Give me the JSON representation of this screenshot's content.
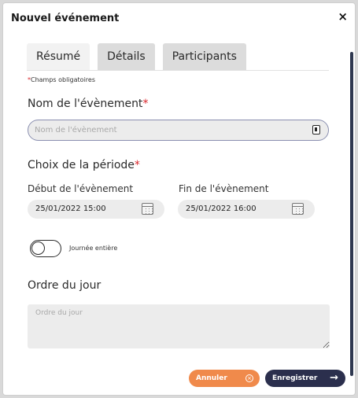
{
  "dialog": {
    "title": "Nouvel événement",
    "close_symbol": "×"
  },
  "tabs": [
    {
      "label": "Résumé",
      "active": true
    },
    {
      "label": "Détails",
      "active": false
    },
    {
      "label": "Participants",
      "active": false
    }
  ],
  "required_note": {
    "star": "*",
    "text": "Champs obligatoires"
  },
  "event_name": {
    "label": "Nom de l'évènement",
    "required_star": "*",
    "value": "",
    "placeholder": "Nom de l'évènement"
  },
  "period": {
    "label": "Choix de la période",
    "required_star": "*",
    "start": {
      "label": "Début de l'évènement",
      "value": "25/01/2022 15:00"
    },
    "end": {
      "label": "Fin de l'évènement",
      "value": "25/01/2022 16:00"
    },
    "all_day": {
      "label": "Journée entière",
      "checked": false
    }
  },
  "agenda": {
    "label": "Ordre du jour",
    "value": "",
    "placeholder": "Ordre du jour"
  },
  "buttons": {
    "cancel": {
      "label": "Annuler",
      "icon": "×"
    },
    "save": {
      "label": "Enregistrer",
      "icon": "→"
    }
  },
  "colors": {
    "cancel": "#f08a4b",
    "save": "#2b2f4d",
    "required": "#d9262b",
    "input_bg": "#ececec"
  }
}
